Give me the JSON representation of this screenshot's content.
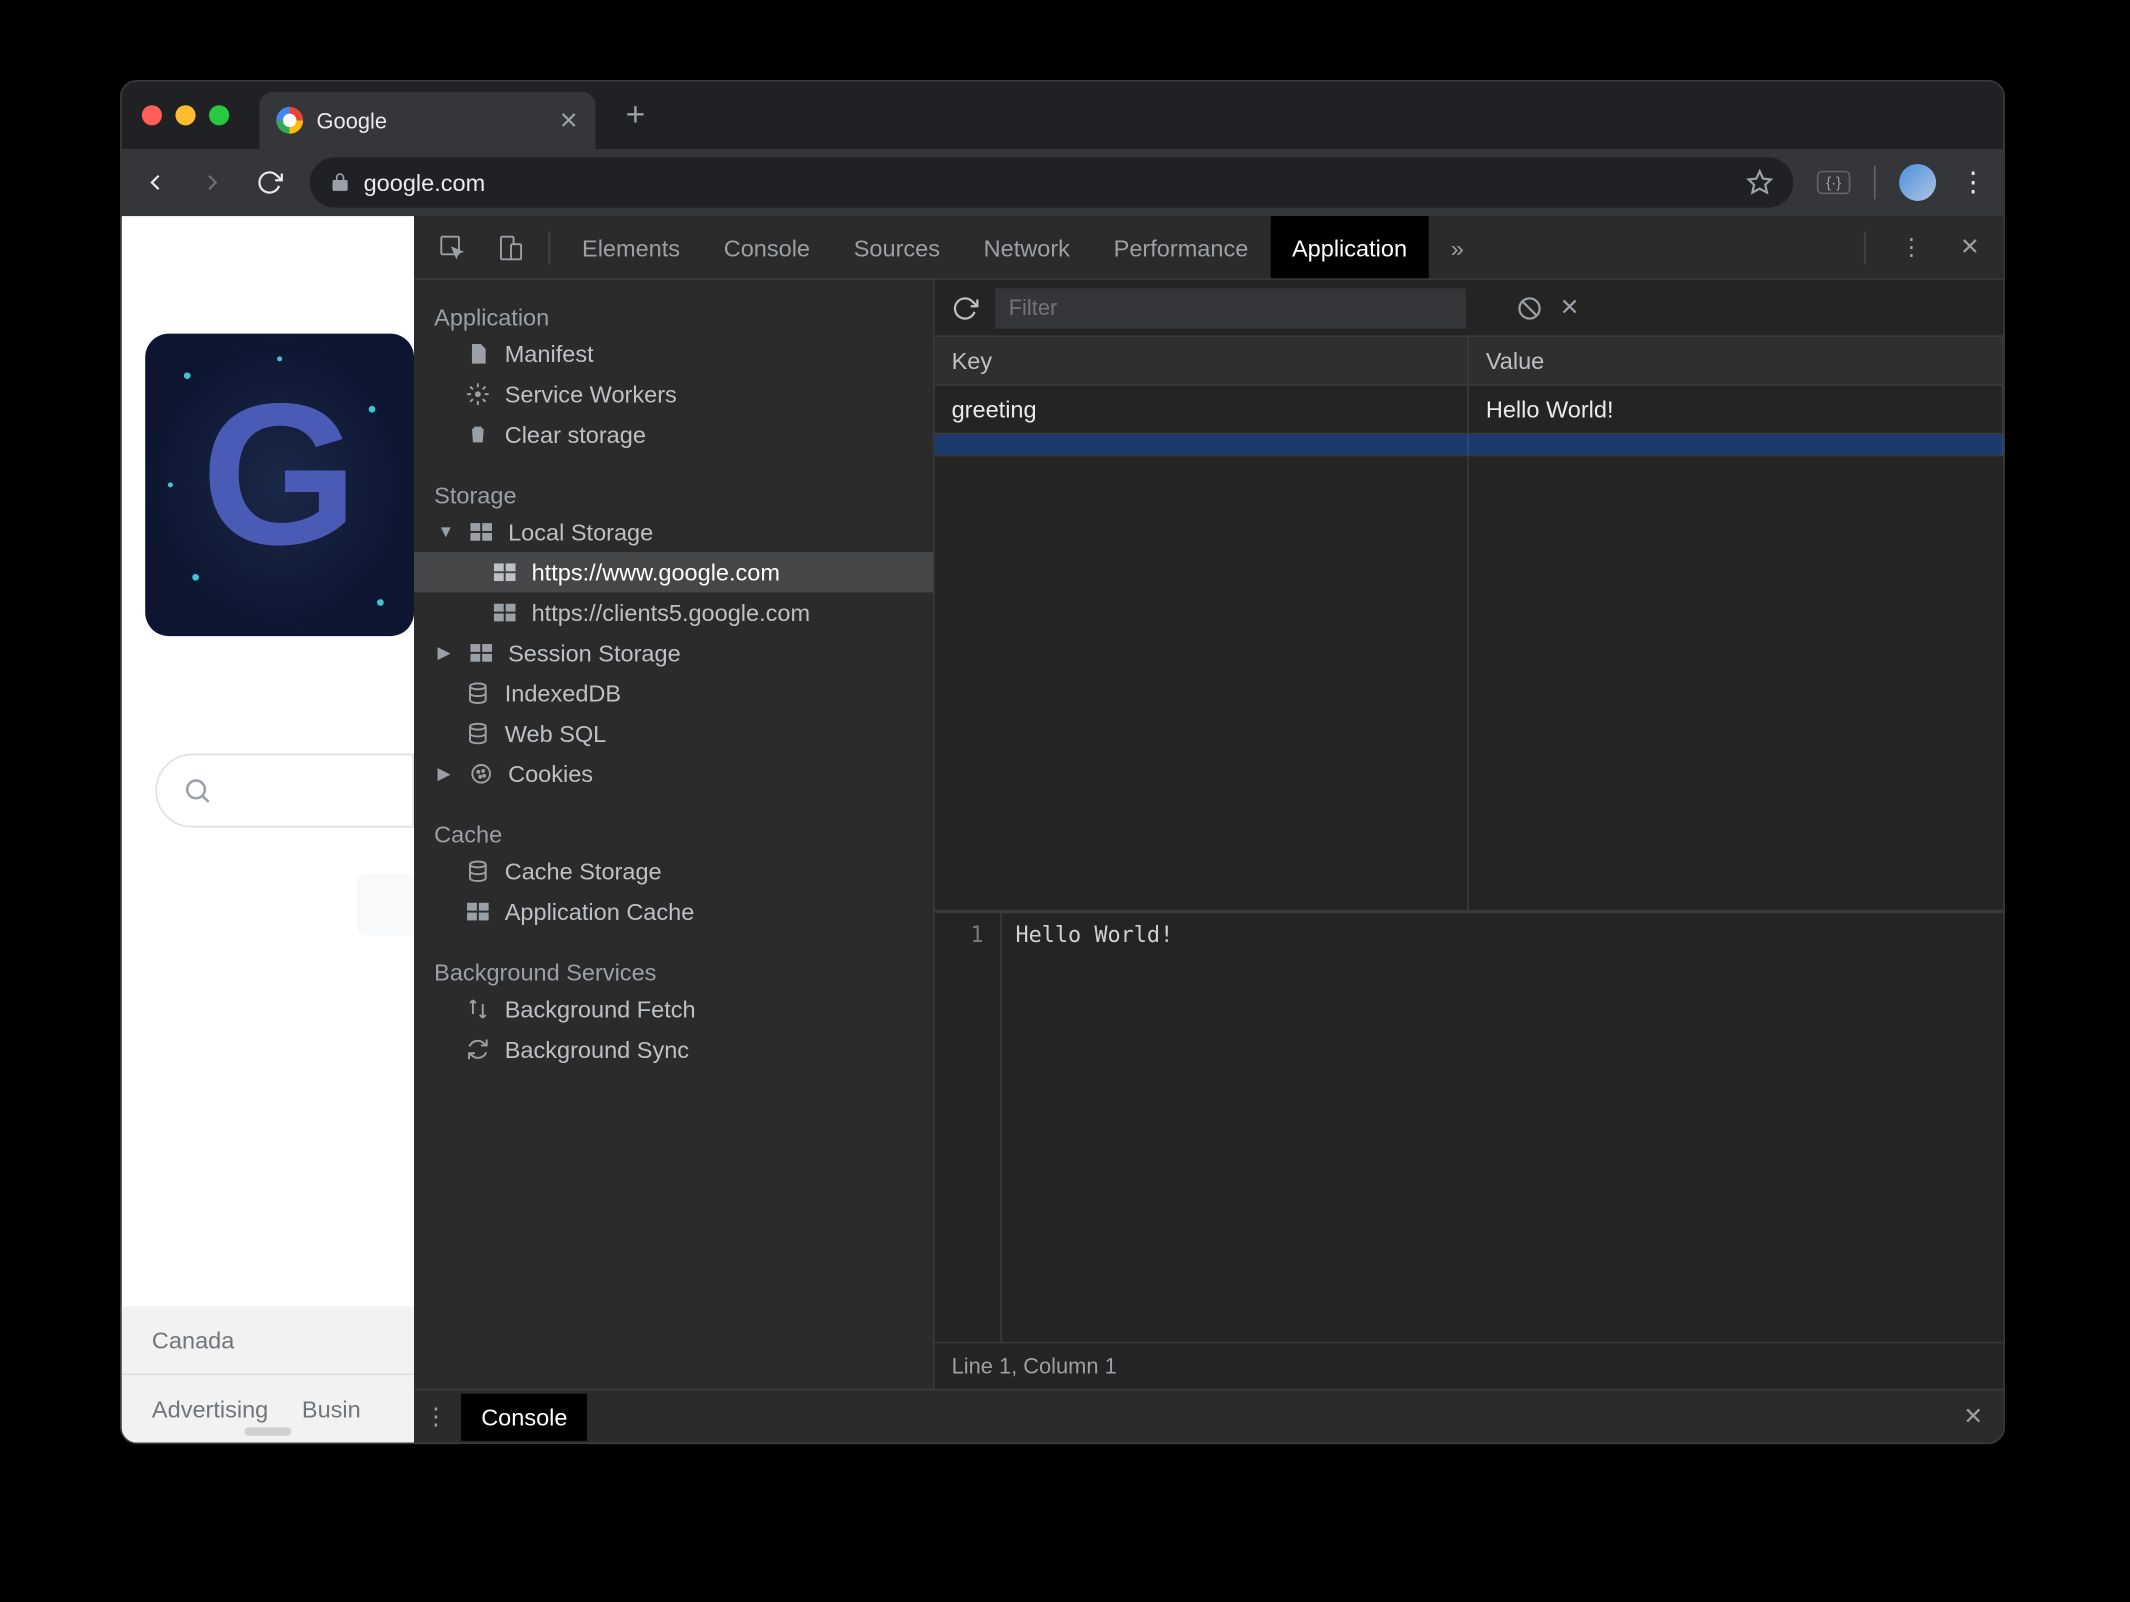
{
  "browser": {
    "tab_title": "Google",
    "url": "google.com",
    "page_country": "Canada",
    "footer_links": [
      "Advertising",
      "Busin"
    ]
  },
  "devtools": {
    "tabs": [
      "Elements",
      "Console",
      "Sources",
      "Network",
      "Performance",
      "Application"
    ],
    "active_tab": "Application",
    "sidebar": {
      "application": {
        "title": "Application",
        "items": [
          "Manifest",
          "Service Workers",
          "Clear storage"
        ]
      },
      "storage": {
        "title": "Storage",
        "local_storage": {
          "label": "Local Storage",
          "origins": [
            "https://www.google.com",
            "https://clients5.google.com"
          ]
        },
        "session_storage": "Session Storage",
        "indexeddb": "IndexedDB",
        "websql": "Web SQL",
        "cookies": "Cookies"
      },
      "cache": {
        "title": "Cache",
        "items": [
          "Cache Storage",
          "Application Cache"
        ]
      },
      "bg": {
        "title": "Background Services",
        "items": [
          "Background Fetch",
          "Background Sync"
        ]
      }
    },
    "storage_toolbar": {
      "filter_placeholder": "Filter"
    },
    "storage_table": {
      "headers": {
        "key": "Key",
        "value": "Value"
      },
      "rows": [
        {
          "key": "greeting",
          "value": "Hello World!"
        }
      ]
    },
    "preview": {
      "line_no": "1",
      "text": "Hello World!"
    },
    "status": "Line 1, Column 1",
    "drawer_tab": "Console"
  }
}
